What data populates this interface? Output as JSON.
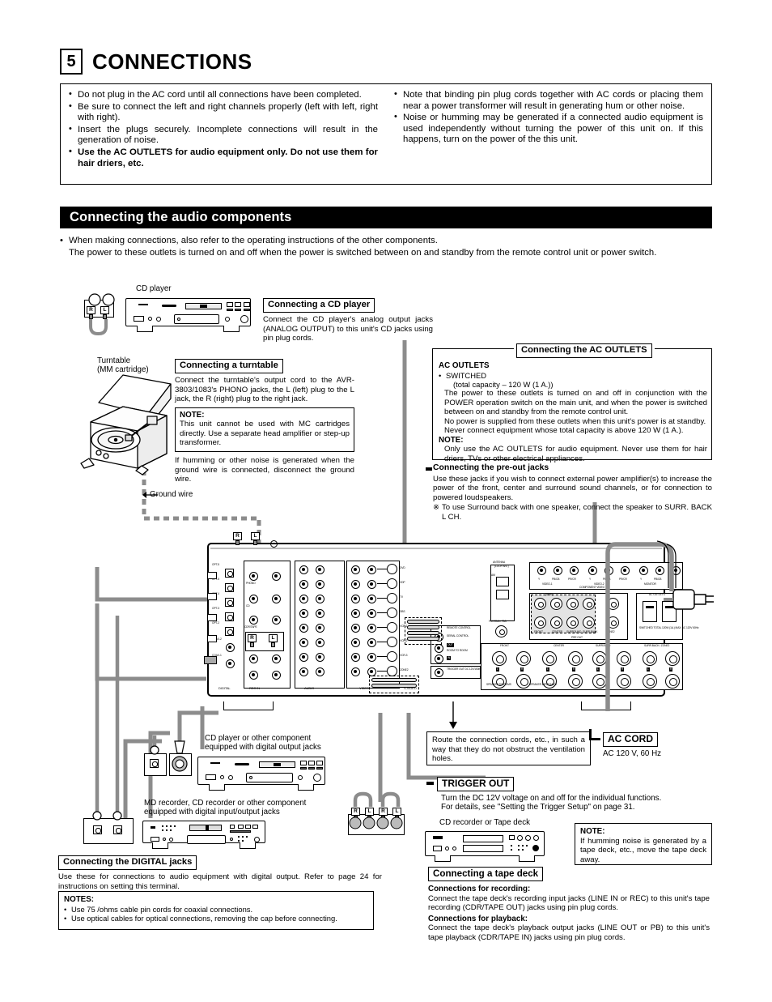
{
  "section": {
    "number": "5",
    "title": "CONNECTIONS"
  },
  "warnings": {
    "left": [
      "Do not plug in the AC cord until all connections have been completed.",
      "Be sure to connect the left and right channels properly (left with left, right with right).",
      "Insert the plugs securely. Incomplete connections will result in the generation of noise.",
      "Use the AC OUTLETS for audio equipment only. Do not use them for hair driers, etc."
    ],
    "right": [
      "Note that binding pin plug cords together with AC cords or placing them near a power transformer will result in generating hum or other noise.",
      "Noise or humming may be generated if a connected audio equipment is used independently without turning the power of this unit on. If this happens, turn on the power of the this unit."
    ]
  },
  "band_title": "Connecting the audio components",
  "intro": {
    "line1": "When making connections, also refer to the operating instructions of the other components.",
    "line2": "The power to these outlets is turned on and off when the power is switched between on and standby from the remote control unit or power switch."
  },
  "cd_player": {
    "caption": "CD player",
    "title": "Connecting a CD player",
    "body": "Connect the CD player's analog output jacks (ANALOG OUTPUT) to this unit's CD jacks using pin plug cords."
  },
  "turntable": {
    "caption_line1": "Turntable",
    "caption_line2": "(MM cartridge)",
    "title": "Connecting a turntable",
    "body": "Connect the turntable's output cord to the AVR-3803/1083's PHONO jacks, the L (left) plug to the L jack, the R (right) plug to the right jack.",
    "note_label": "NOTE:",
    "note_body": "This unit cannot be used with MC cartridges directly. Use a separate head amplifier or step-up transformer.",
    "after_note": "If humming or other noise is generated when the ground wire is connected, disconnect the ground wire.",
    "ground_wire_label": "Ground wire"
  },
  "ac_outlets": {
    "title": "Connecting the AC OUTLETS",
    "heading": "AC OUTLETS",
    "bullet": "SWITCHED",
    "capacity": "(total capacity – 120 W (1 A.))",
    "p1": "The power to these outlets is turned on and off in conjunction with the POWER operation switch on the main unit, and when the power is switched between on and standby from the remote control unit.",
    "p2": "No power is supplied from these outlets when this unit's power is at standby.",
    "p3": "Never connect equipment whose total capacity is above 120 W (1 A.).",
    "note_label": "NOTE:",
    "note_body": "Only use the AC OUTLETS for audio equipment. Never use them for hair driers, TVs or other electrical appliances."
  },
  "preout": {
    "title": "Connecting the pre-out jacks",
    "body": "Use these jacks if you wish to connect external power amplifier(s) to increase the power of the front, center and surround sound channels, or for connection to powered loudspeakers.",
    "note_mark": "※",
    "note": "To use Surround back with one speaker, connect the speaker to SURR. BACK L CH."
  },
  "digital": {
    "cd_caption_1": "CD player or other component",
    "cd_caption_2": "equipped with digital output jacks",
    "md_caption_1": "MD recorder, CD recorder or other component",
    "md_caption_2": "equipped with digital input/output jacks",
    "title": "Connecting the DIGITAL jacks",
    "body": "Use these for connections to audio equipment with digital output. Refer to page 24 for instructions on setting this terminal.",
    "notes_label": "NOTES:",
    "note1": "Use 75    /ohms cable pin cords for coaxial connections.",
    "note2": "Use optical cables for optical connections, removing the cap before connecting."
  },
  "routing": {
    "body": "Route the connection cords, etc., in such a way that they do not obstruct the ventilation holes."
  },
  "ac_cord": {
    "title": "AC CORD",
    "body": "AC 120 V, 60 Hz"
  },
  "trigger": {
    "title": "TRIGGER OUT",
    "line1": "Turn the DC 12V voltage on and off for the individual functions.",
    "line2": "For details, see \"Setting the Trigger Setup\" on page 31."
  },
  "tape": {
    "caption": "CD recorder or Tape deck",
    "title": "Connecting a tape deck",
    "rec_label": "Connections for recording:",
    "rec_body": "Connect the tape deck's recording input jacks (LINE IN or REC) to this unit's tape recording (CDR/TAPE OUT) jacks using pin plug cords.",
    "pb_label": "Connections for playback:",
    "pb_body": "Connect the tape deck's playback output jacks (LINE OUT or PB) to this unit's tape playback (CDR/TAPE IN) jacks using pin plug cords.",
    "note_label": "NOTE:",
    "note_body": "If humming noise is generated by a tape deck, etc., move the tape deck away."
  },
  "rear_panel": {
    "digital_section": "DIGITAL",
    "opt_labels": [
      "OPT-5",
      "OPT-5",
      "OPT-4",
      "OPT-3",
      "OPT-2",
      "OPT-1"
    ],
    "coax_labels": [
      "COAX-2",
      "COAX-1"
    ],
    "audio_section": "AUDIO",
    "video_section": "VIDEO",
    "svideo_section": "S-VIDEO",
    "phono_label": "PHONO",
    "cd_label": "CD",
    "cdr_tape_label": "CDR/TAPE",
    "antenna_label": "ANTENNA",
    "loop_ant_label": "(LOOP ANT)",
    "am_label": "AM",
    "fm_label": "FM COAX. 75Ω",
    "component_video_label": "COMPONENT VIDEO",
    "component_groups": [
      "VIDEO-1",
      "VIDEO-2",
      "MONITOR"
    ],
    "component_pins": [
      "Y",
      "PB/CB",
      "PR/CR"
    ],
    "preout_label": "PRE OUT",
    "preout_groups": [
      "FRONT",
      "CENTER",
      "SURROUND",
      "SURR.BACK",
      "ZONE2"
    ],
    "ac_outlets_label": "AC OUTLETS",
    "ac_outlets_sub": "SWITCHED TOTAL 120W (1A.) MAX. AC 120V 60Hz",
    "speaker_label": "SPEAKER SYSTEMS",
    "speaker_impedance": "SPEAKER IMPEDANCE",
    "speaker_groups": [
      "FRONT",
      "CENTER",
      "SURROUND",
      "SURR.BACK / ZONE2"
    ],
    "remote_control_label": "REMOTE CONTROL",
    "serial_control_label": "SERIAL CONTROL",
    "room_to_room_label": "ROOM TO ROOM",
    "trigger_out_label": "TRIGGER OUT DC 12V/150mA MAX",
    "lr_labels": [
      "L",
      "R"
    ],
    "video_rows": [
      "DVD",
      "VDP",
      "TV",
      "DBS",
      "VCR-1",
      "VCR-2",
      "VCR-3",
      "ZONE2"
    ]
  },
  "plug_labels": {
    "right": "R",
    "left": "L"
  }
}
